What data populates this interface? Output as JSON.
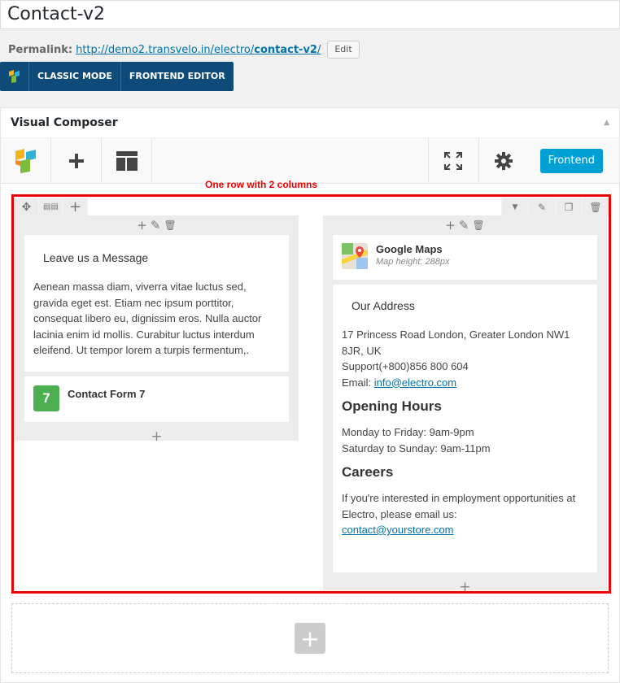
{
  "post_title": "Contact-v2",
  "permalink": {
    "label": "Permalink:",
    "url_prefix": "http://demo2.transvelo.in/electro/",
    "slug": "contact-v2",
    "url_suffix": "/",
    "edit_label": "Edit"
  },
  "modebar": {
    "classic": "CLASSIC MODE",
    "frontend": "FRONTEND EDITOR"
  },
  "composer": {
    "title": "Visual Composer",
    "frontend_button": "Frontend"
  },
  "annotation": "One row with 2 columns",
  "left_column": {
    "text_block_title": "Leave us a Message",
    "text_block_body": "Aenean massa diam, viverra vitae luctus sed, gravida eget est. Etiam nec ipsum porttitor, consequat libero eu, dignissim eros. Nulla auctor lacinia enim id mollis. Curabitur luctus interdum eleifend. Ut tempor lorem a turpis fermentum,.",
    "contact_form_icon": "7",
    "contact_form_label": "Contact Form 7"
  },
  "right_column": {
    "maps_label": "Google Maps",
    "maps_height": "Map height: 288px",
    "address_title": "Our Address",
    "address_line1": "17 Princess Road London, Greater London NW1 8JR, UK",
    "support": "Support(+800)856 800 604",
    "email_label": "Email:",
    "email_link": "info@electro.com",
    "opening_heading": "Opening Hours",
    "hours_weekday": "Monday to Friday: 9am-9pm",
    "hours_weekend": "Saturday to Sunday: 9am-11pm",
    "careers_heading": "Careers",
    "careers_text": "If you're interested in employment opportunities at Electro, please email us:",
    "careers_email": "contact@yourstore.com"
  },
  "colors": {
    "accent": "#0f4b78",
    "frontend_button": "#00a0d2",
    "annotation": "#ee0000",
    "contact_form_icon": "#4caf50"
  }
}
